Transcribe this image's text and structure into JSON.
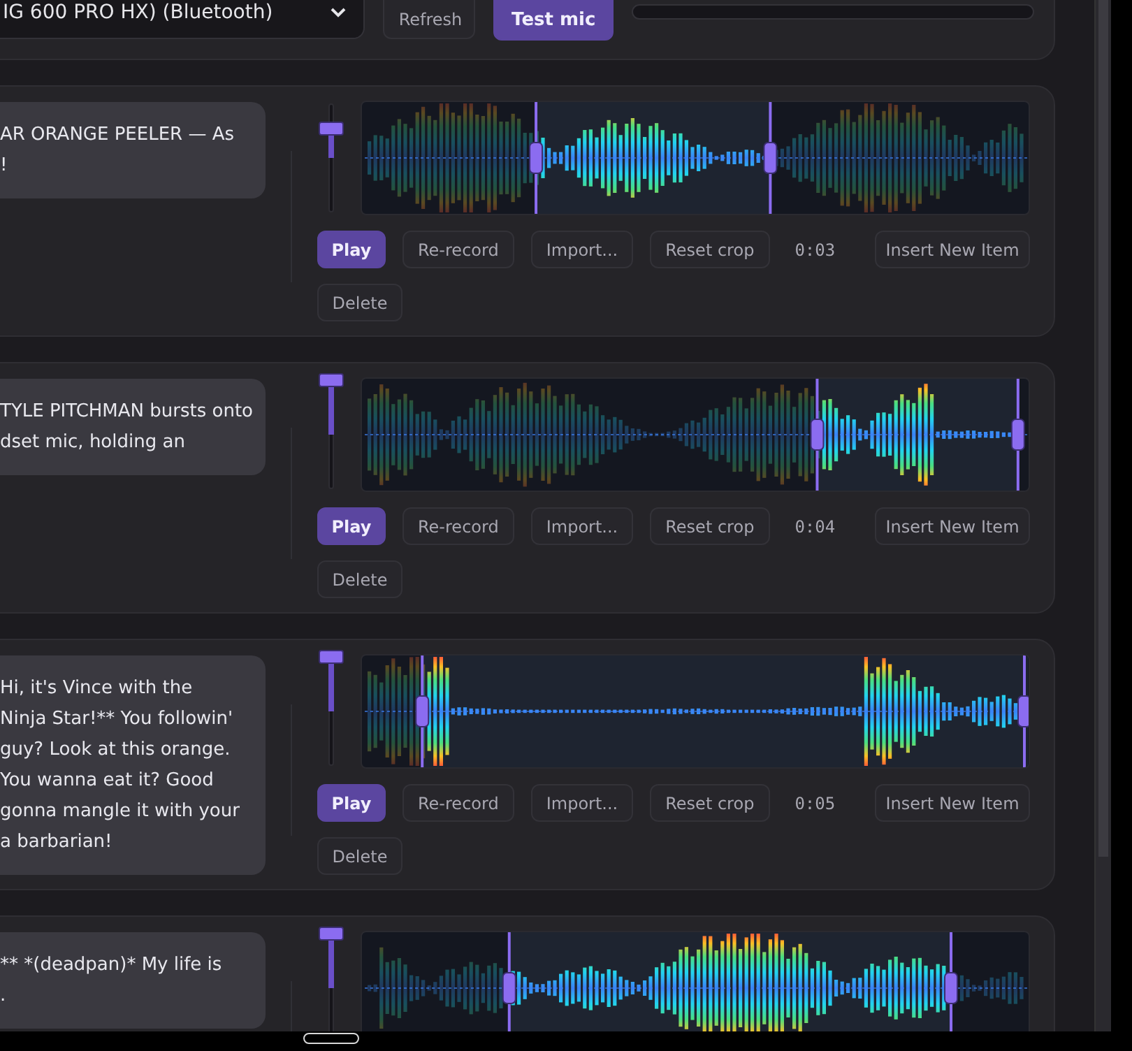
{
  "device_select": {
    "value": "IG 600 PRO HX) (Bluetooth)"
  },
  "refresh_button": "Refresh",
  "test_mic_button": "Test mic",
  "mic_meter": {
    "level": 0
  },
  "cards": [
    {
      "lines": [
        "AR ORANGE PEELER — As",
        "!"
      ],
      "volume": {
        "level": 0.77
      },
      "crop_start": {
        "level": 0.26
      },
      "crop_end": {
        "level": 0.61
      },
      "buttons": [
        {
          "label": "Play",
          "kind": "primary"
        },
        {
          "label": "Re-record",
          "kind": "secondary"
        },
        {
          "label": "Import...",
          "kind": "secondary"
        },
        {
          "label": "Reset crop",
          "kind": "secondary"
        }
      ],
      "duration": "0:03",
      "insert_button": "Insert New Item",
      "delete_button": "Delete"
    },
    {
      "lines": [
        "TYLE PITCHMAN bursts onto",
        "dset mic, holding an"
      ],
      "volume": {
        "level": 1
      },
      "crop_start": {
        "level": 0.68
      },
      "crop_end": {
        "level": 0.98
      },
      "buttons": [
        {
          "label": "Play",
          "kind": "primary"
        },
        {
          "label": "Re-record",
          "kind": "secondary"
        },
        {
          "label": "Import...",
          "kind": "secondary"
        },
        {
          "label": "Reset crop",
          "kind": "secondary"
        }
      ],
      "duration": "0:04",
      "insert_button": "Insert New Item",
      "delete_button": "Delete"
    },
    {
      "lines": [
        "Hi, it's Vince with the",
        "Ninja Star!** You followin'",
        "guy? Look at this orange.",
        "You wanna eat it? Good",
        "gonna mangle it with your",
        "a barbarian!"
      ],
      "volume": {
        "level": 1
      },
      "crop_start": {
        "level": 0.09
      },
      "crop_end": {
        "level": 0.995
      },
      "buttons": [
        {
          "label": "Play",
          "kind": "primary"
        },
        {
          "label": "Re-record",
          "kind": "secondary"
        },
        {
          "label": "Import...",
          "kind": "secondary"
        },
        {
          "label": "Reset crop",
          "kind": "secondary"
        }
      ],
      "duration": "0:05",
      "insert_button": "Insert New Item",
      "delete_button": "Delete"
    },
    {
      "lines": [
        "** *(deadpan)* My life is",
        "."
      ],
      "volume": {
        "level": 1
      },
      "crop_start": {
        "level": 0.22
      },
      "crop_end": {
        "level": 0.88
      }
    }
  ]
}
